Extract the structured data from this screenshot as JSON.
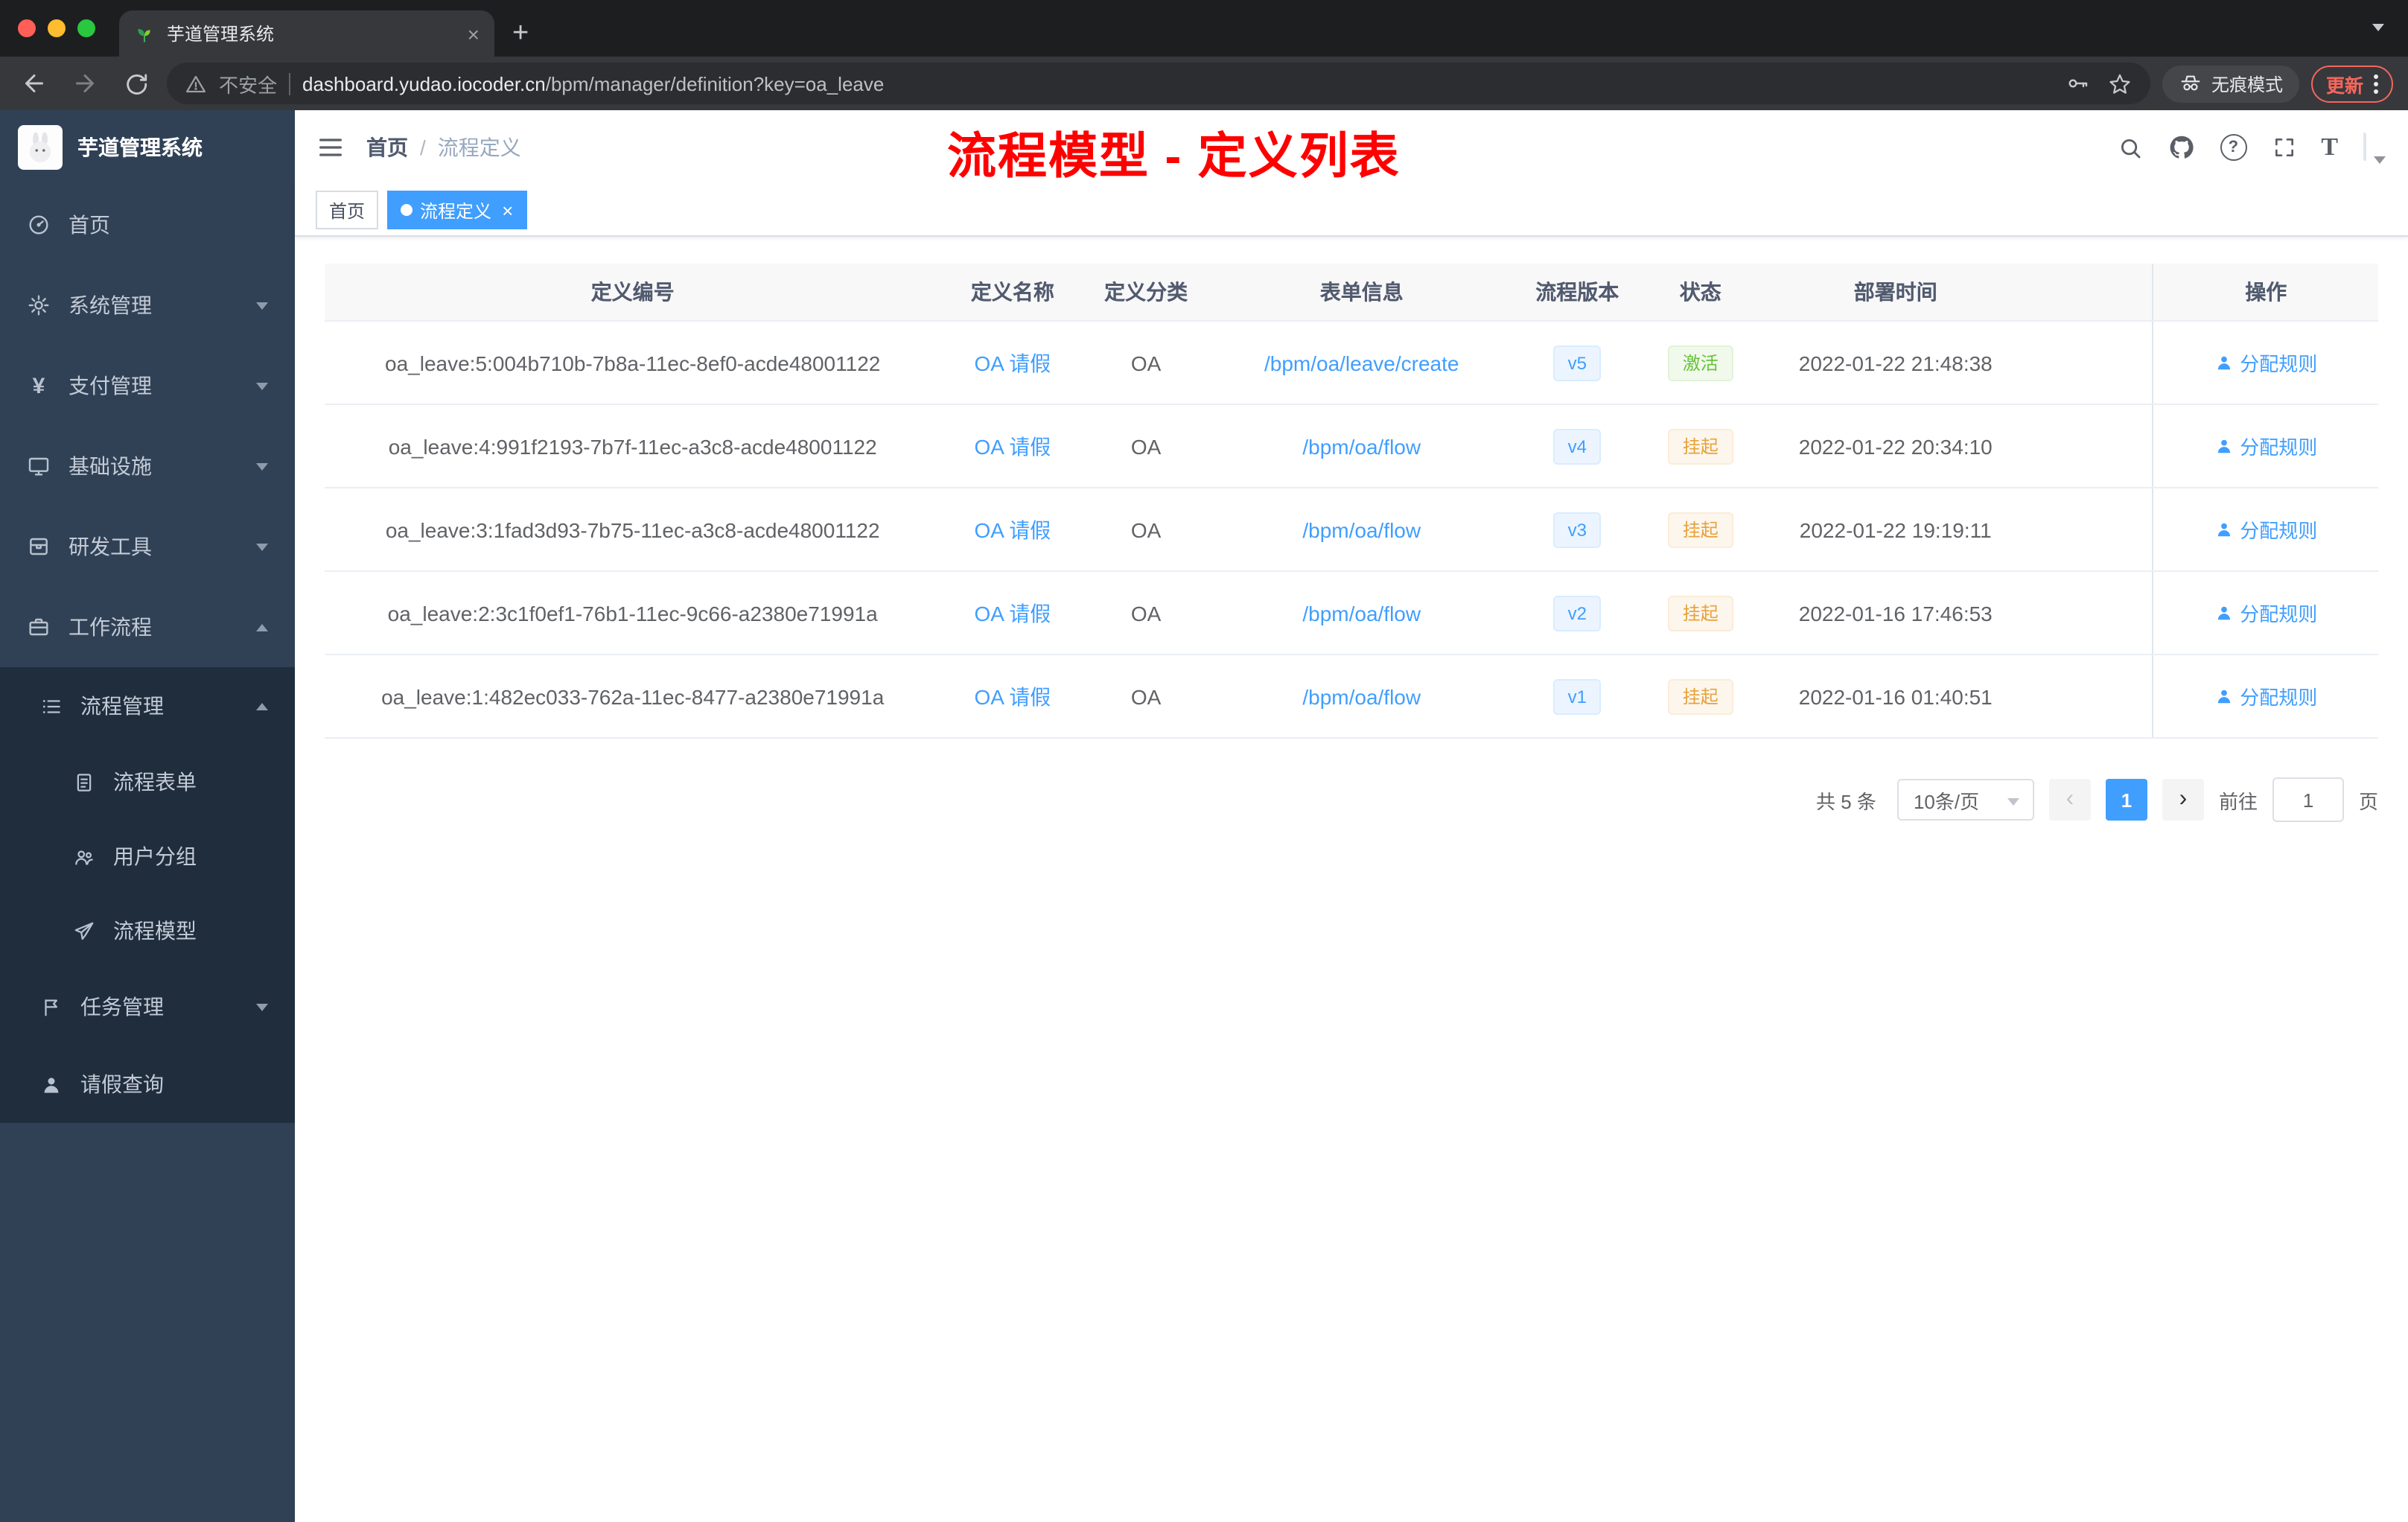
{
  "colors": {
    "accent": "#409eff",
    "success": "#67c23a",
    "warning": "#e6a23c",
    "annotation_red": "#fe0000",
    "sidebar_bg": "#304156"
  },
  "browser": {
    "tab_title": "芋道管理系统",
    "close_tab": "×",
    "new_tab": "+",
    "security_label": "不安全",
    "url_host": "dashboard.yudao.iocoder.cn",
    "url_path": "/bpm/manager/definition?key=oa_leave",
    "incognito_label": "无痕模式",
    "update_label": "更新"
  },
  "sidebar": {
    "title": "芋道管理系统",
    "items": [
      {
        "label": "首页"
      },
      {
        "label": "系统管理"
      },
      {
        "label": "支付管理"
      },
      {
        "label": "基础设施"
      },
      {
        "label": "研发工具"
      },
      {
        "label": "工作流程"
      }
    ],
    "submenu": [
      {
        "label": "流程管理"
      },
      {
        "label": "流程表单"
      },
      {
        "label": "用户分组"
      },
      {
        "label": "流程模型"
      },
      {
        "label": "任务管理"
      },
      {
        "label": "请假查询"
      }
    ]
  },
  "navbar": {
    "breadcrumb_home": "首页",
    "breadcrumb_separator": "/",
    "breadcrumb_current": "流程定义",
    "annotation": "流程模型 - 定义列表",
    "question_glyph": "?",
    "font_size_glyph": "T"
  },
  "tags": {
    "home": "首页",
    "active": "流程定义",
    "close": "×"
  },
  "table": {
    "columns": [
      "定义编号",
      "定义名称",
      "定义分类",
      "表单信息",
      "流程版本",
      "状态",
      "部署时间",
      "操作"
    ],
    "rows": [
      {
        "id": "oa_leave:5:004b710b-7b8a-11ec-8ef0-acde48001122",
        "name": "OA 请假",
        "category": "OA",
        "form": "/bpm/oa/leave/create",
        "version": "v5",
        "status": "激活",
        "time": "2022-01-22 21:48:38",
        "action": "分配规则"
      },
      {
        "id": "oa_leave:4:991f2193-7b7f-11ec-a3c8-acde48001122",
        "name": "OA 请假",
        "category": "OA",
        "form": "/bpm/oa/flow",
        "version": "v4",
        "status": "挂起",
        "time": "2022-01-22 20:34:10",
        "action": "分配规则"
      },
      {
        "id": "oa_leave:3:1fad3d93-7b75-11ec-a3c8-acde48001122",
        "name": "OA 请假",
        "category": "OA",
        "form": "/bpm/oa/flow",
        "version": "v3",
        "status": "挂起",
        "time": "2022-01-22 19:19:11",
        "action": "分配规则"
      },
      {
        "id": "oa_leave:2:3c1f0ef1-76b1-11ec-9c66-a2380e71991a",
        "name": "OA 请假",
        "category": "OA",
        "form": "/bpm/oa/flow",
        "version": "v2",
        "status": "挂起",
        "time": "2022-01-16 17:46:53",
        "action": "分配规则"
      },
      {
        "id": "oa_leave:1:482ec033-762a-11ec-8477-a2380e71991a",
        "name": "OA 请假",
        "category": "OA",
        "form": "/bpm/oa/flow",
        "version": "v1",
        "status": "挂起",
        "time": "2022-01-16 01:40:51",
        "action": "分配规则"
      }
    ]
  },
  "pagination": {
    "total": "共 5 条",
    "page_size": "10条/页",
    "prev": "‹",
    "page": "1",
    "next": "›",
    "goto_label": "前往",
    "goto_value": "1",
    "unit_label": "页"
  }
}
